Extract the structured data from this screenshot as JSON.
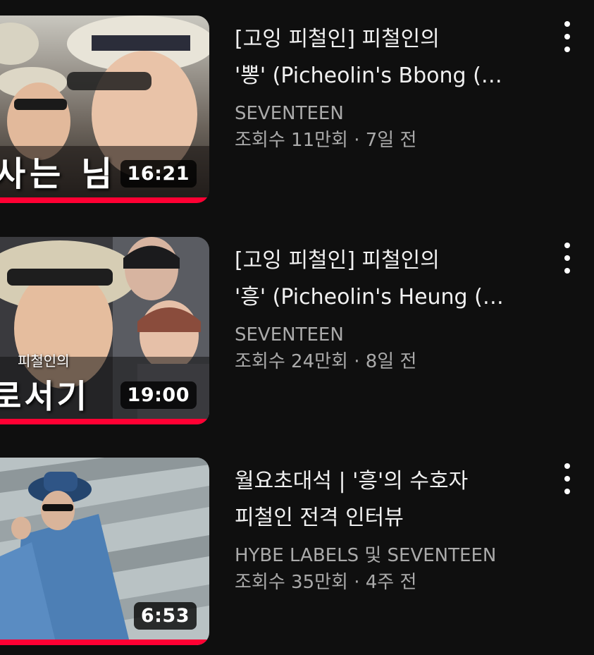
{
  "videos": [
    {
      "title_line1": "[고잉 피철인] 피철인의",
      "title_line2": "'뽕' (Picheolin's Bbong (…",
      "channel": "SEVENTEEN",
      "meta": "조회수 11만회 · 7일 전",
      "duration": "16:21",
      "thumb_caption": "사는 님",
      "watched_fraction": 1.0
    },
    {
      "title_line1": "[고잉 피철인] 피철인의",
      "title_line2": "'흥' (Picheolin's Heung (…",
      "channel": "SEVENTEEN",
      "meta": "조회수 24만회 · 8일 전",
      "duration": "19:00",
      "thumb_caption_small": "피철인의",
      "thumb_caption": "로서기",
      "watched_fraction": 1.0
    },
    {
      "title_line1": "월요초대석 | '흥'의 수호자",
      "title_line2": "피철인 전격 인터뷰",
      "channel": "HYBE LABELS 및 SEVENTEEN",
      "meta": "조회수 35만회 · 4주 전",
      "duration": "6:53",
      "watched_fraction": 1.0
    }
  ],
  "colors": {
    "background": "#0f0f0f",
    "progress": "#ff0033",
    "title": "#f1f1f1",
    "secondary": "#aaaaaa"
  },
  "icons": {
    "more": "more-vertical-icon"
  }
}
